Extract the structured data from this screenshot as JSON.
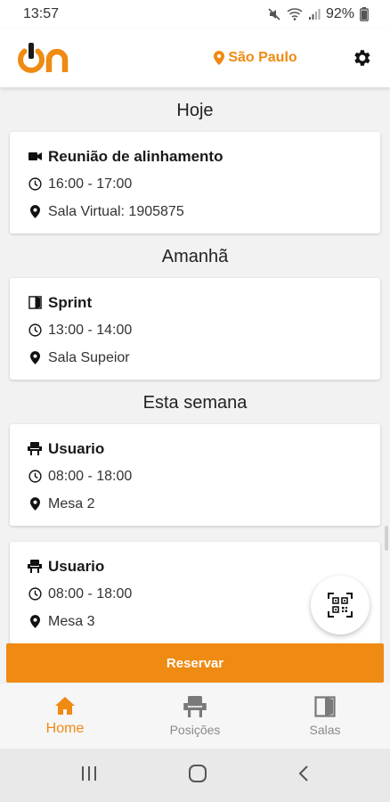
{
  "status_bar": {
    "time": "13:57",
    "battery": "92%"
  },
  "app_bar": {
    "logo_text": "On",
    "location": "São Paulo"
  },
  "sections": [
    {
      "title": "Hoje",
      "cards": [
        {
          "title": "Reunião de alinhamento",
          "time": "16:00 - 17:00",
          "place": "Sala Virtual: 1905875",
          "type_icon": "video-camera-icon"
        }
      ]
    },
    {
      "title": "Amanhã",
      "cards": [
        {
          "title": "Sprint",
          "time": "13:00 - 14:00",
          "place": "Sala Supeior",
          "type_icon": "door-icon"
        }
      ]
    },
    {
      "title": "Esta semana",
      "cards": [
        {
          "title": "Usuario",
          "time": "08:00 - 18:00",
          "place": "Mesa 2",
          "type_icon": "chair-icon"
        },
        {
          "title": "Usuario",
          "time": "08:00 - 18:00",
          "place": "Mesa 3",
          "type_icon": "chair-icon"
        }
      ]
    }
  ],
  "reserve_button": "Reservar",
  "bottom_nav": [
    {
      "label": "Home",
      "icon": "home-icon",
      "active": true
    },
    {
      "label": "Posições",
      "icon": "chair-icon",
      "active": false
    },
    {
      "label": "Salas",
      "icon": "door-icon",
      "active": false
    }
  ],
  "colors": {
    "accent": "#ef8a12",
    "background": "#f2f2f2",
    "card": "#ffffff"
  }
}
